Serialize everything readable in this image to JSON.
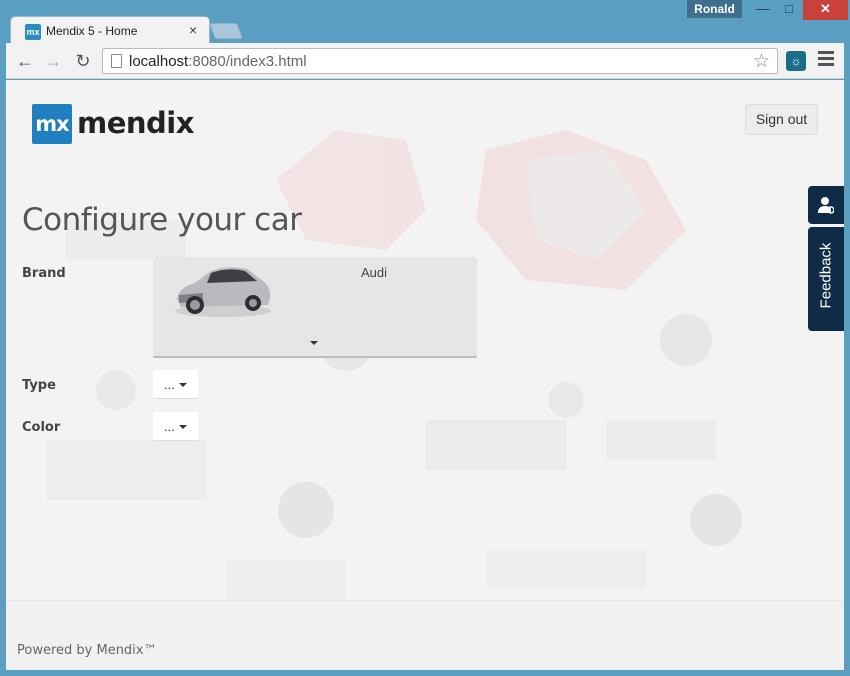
{
  "browser": {
    "user_badge": "Ronald",
    "tab_title": "Mendix 5 - Home",
    "favicon_text": "mx",
    "url_host": "localhost",
    "url_rest": ":8080/index3.html",
    "icons": [
      "back-arrow-icon",
      "forward-arrow-icon",
      "reload-icon",
      "page-icon",
      "star-icon",
      "extension-icon",
      "menu-icon"
    ]
  },
  "app": {
    "logo_mark": "mx",
    "logo_name": "mendix",
    "sign_out": "Sign out",
    "feedback": "Feedback",
    "accent": "#1f7fbf",
    "sidebar_color": "#0f2b45"
  },
  "form": {
    "heading": "Configure your car",
    "brand": {
      "label": "Brand",
      "value": "Audi"
    },
    "type": {
      "label": "Type",
      "value": "..."
    },
    "color": {
      "label": "Color",
      "value": "..."
    }
  },
  "footer": {
    "powered_by": "Powered by Mendix™"
  }
}
